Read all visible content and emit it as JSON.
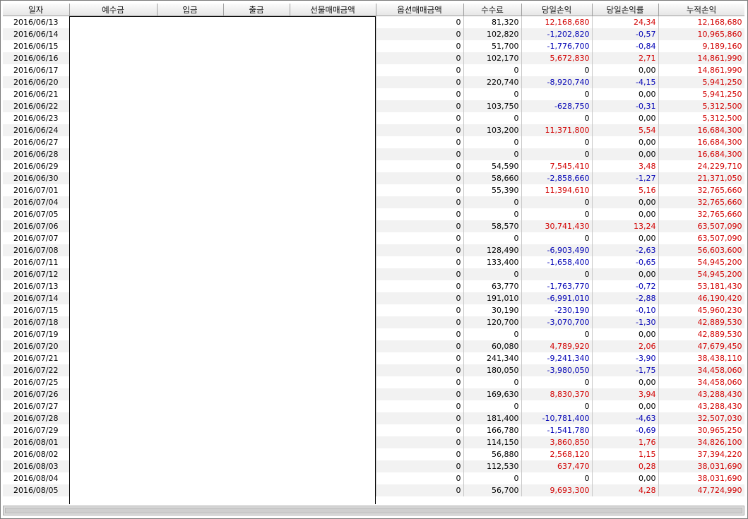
{
  "columns": [
    "일자",
    "예수금",
    "입금",
    "출금",
    "선물매매금액",
    "옵션매매금액",
    "수수료",
    "당일손익",
    "당일손익률",
    "누적손익"
  ],
  "rows": [
    [
      "2016/06/13",
      "0",
      "81,320",
      "12,168,680",
      "24,34",
      "12,168,680"
    ],
    [
      "2016/06/14",
      "0",
      "102,820",
      "-1,202,820",
      "-0,57",
      "10,965,860"
    ],
    [
      "2016/06/15",
      "0",
      "51,700",
      "-1,776,700",
      "-0,84",
      "9,189,160"
    ],
    [
      "2016/06/16",
      "0",
      "102,170",
      "5,672,830",
      "2,71",
      "14,861,990"
    ],
    [
      "2016/06/17",
      "0",
      "0",
      "0",
      "0,00",
      "14,861,990"
    ],
    [
      "2016/06/20",
      "0",
      "220,740",
      "-8,920,740",
      "-4,15",
      "5,941,250"
    ],
    [
      "2016/06/21",
      "0",
      "0",
      "0",
      "0,00",
      "5,941,250"
    ],
    [
      "2016/06/22",
      "0",
      "103,750",
      "-628,750",
      "-0,31",
      "5,312,500"
    ],
    [
      "2016/06/23",
      "0",
      "0",
      "0",
      "0,00",
      "5,312,500"
    ],
    [
      "2016/06/24",
      "0",
      "103,200",
      "11,371,800",
      "5,54",
      "16,684,300"
    ],
    [
      "2016/06/27",
      "0",
      "0",
      "0",
      "0,00",
      "16,684,300"
    ],
    [
      "2016/06/28",
      "0",
      "0",
      "0",
      "0,00",
      "16,684,300"
    ],
    [
      "2016/06/29",
      "0",
      "54,590",
      "7,545,410",
      "3,48",
      "24,229,710"
    ],
    [
      "2016/06/30",
      "0",
      "58,660",
      "-2,858,660",
      "-1,27",
      "21,371,050"
    ],
    [
      "2016/07/01",
      "0",
      "55,390",
      "11,394,610",
      "5,16",
      "32,765,660"
    ],
    [
      "2016/07/04",
      "0",
      "0",
      "0",
      "0,00",
      "32,765,660"
    ],
    [
      "2016/07/05",
      "0",
      "0",
      "0",
      "0,00",
      "32,765,660"
    ],
    [
      "2016/07/06",
      "0",
      "58,570",
      "30,741,430",
      "13,24",
      "63,507,090"
    ],
    [
      "2016/07/07",
      "0",
      "0",
      "0",
      "0,00",
      "63,507,090"
    ],
    [
      "2016/07/08",
      "0",
      "128,490",
      "-6,903,490",
      "-2,63",
      "56,603,600"
    ],
    [
      "2016/07/11",
      "0",
      "133,400",
      "-1,658,400",
      "-0,65",
      "54,945,200"
    ],
    [
      "2016/07/12",
      "0",
      "0",
      "0",
      "0,00",
      "54,945,200"
    ],
    [
      "2016/07/13",
      "0",
      "63,770",
      "-1,763,770",
      "-0,72",
      "53,181,430"
    ],
    [
      "2016/07/14",
      "0",
      "191,010",
      "-6,991,010",
      "-2,88",
      "46,190,420"
    ],
    [
      "2016/07/15",
      "0",
      "30,190",
      "-230,190",
      "-0,10",
      "45,960,230"
    ],
    [
      "2016/07/18",
      "0",
      "120,700",
      "-3,070,700",
      "-1,30",
      "42,889,530"
    ],
    [
      "2016/07/19",
      "0",
      "0",
      "0",
      "0,00",
      "42,889,530"
    ],
    [
      "2016/07/20",
      "0",
      "60,080",
      "4,789,920",
      "2,06",
      "47,679,450"
    ],
    [
      "2016/07/21",
      "0",
      "241,340",
      "-9,241,340",
      "-3,90",
      "38,438,110"
    ],
    [
      "2016/07/22",
      "0",
      "180,050",
      "-3,980,050",
      "-1,75",
      "34,458,060"
    ],
    [
      "2016/07/25",
      "0",
      "0",
      "0",
      "0,00",
      "34,458,060"
    ],
    [
      "2016/07/26",
      "0",
      "169,630",
      "8,830,370",
      "3,94",
      "43,288,430"
    ],
    [
      "2016/07/27",
      "0",
      "0",
      "0",
      "0,00",
      "43,288,430"
    ],
    [
      "2016/07/28",
      "0",
      "181,400",
      "-10,781,400",
      "-4,63",
      "32,507,030"
    ],
    [
      "2016/07/29",
      "0",
      "166,780",
      "-1,541,780",
      "-0,69",
      "30,965,250"
    ],
    [
      "2016/08/01",
      "0",
      "114,150",
      "3,860,850",
      "1,76",
      "34,826,100"
    ],
    [
      "2016/08/02",
      "0",
      "56,880",
      "2,568,120",
      "1,15",
      "37,394,220"
    ],
    [
      "2016/08/03",
      "0",
      "112,530",
      "637,470",
      "0,28",
      "38,031,690"
    ],
    [
      "2016/08/04",
      "0",
      "0",
      "0",
      "0,00",
      "38,031,690"
    ],
    [
      "2016/08/05",
      "0",
      "56,700",
      "9,693,300",
      "4,28",
      "47,724,990"
    ]
  ],
  "colors": {
    "positive": "#d20000",
    "negative": "#0000b4",
    "zebra": "#f2f2f2"
  }
}
